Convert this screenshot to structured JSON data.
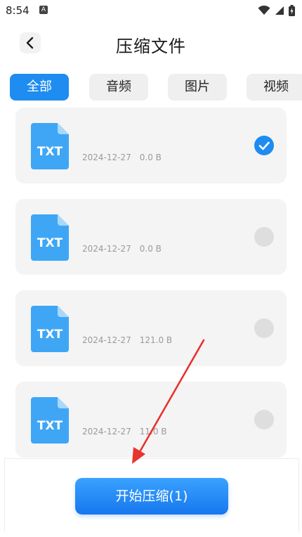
{
  "status_bar": {
    "time": "8:54",
    "notification_badge": "A"
  },
  "header": {
    "title": "压缩文件"
  },
  "tabs": [
    {
      "label": "全部",
      "active": true
    },
    {
      "label": "音频",
      "active": false
    },
    {
      "label": "图片",
      "active": false
    },
    {
      "label": "视频",
      "active": false
    }
  ],
  "files": [
    {
      "type_label": "TXT",
      "date": "2024-12-27",
      "size": "0.0 B",
      "selected": true
    },
    {
      "type_label": "TXT",
      "date": "2024-12-27",
      "size": "0.0 B",
      "selected": false
    },
    {
      "type_label": "TXT",
      "date": "2024-12-27",
      "size": "121.0 B",
      "selected": false
    },
    {
      "type_label": "TXT",
      "date": "2024-12-27",
      "size": "11.0 B",
      "selected": false
    }
  ],
  "actions": {
    "compress_label": "开始压缩(1)"
  },
  "colors": {
    "accent": "#1e8cf0",
    "arrow": "#e8322e"
  }
}
